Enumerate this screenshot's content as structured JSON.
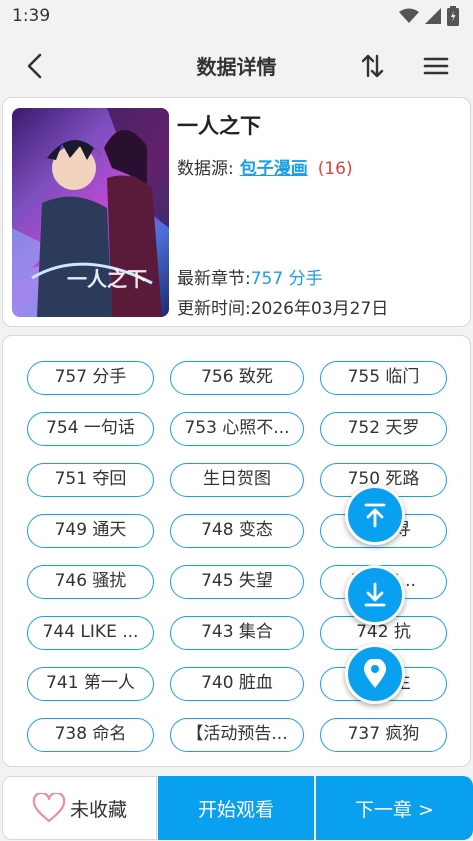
{
  "status_bar": {
    "time": "1:39",
    "icons": [
      "wifi-icon",
      "signal-icon",
      "battery-icon"
    ]
  },
  "toolbar": {
    "title": "数据详情",
    "icons": [
      "back-arrow-icon",
      "sort-icon",
      "menu-icon"
    ]
  },
  "comic": {
    "title": "一人之下",
    "source_label": "数据源:",
    "source_name": "包子漫画",
    "source_count": "(16)",
    "latest_label": "最新章节:",
    "latest_value": "757 分手",
    "updated_label": "更新时间:",
    "updated_value": "2026年03月27日"
  },
  "chapters": [
    "757 分手",
    "756 致死",
    "755 临门",
    "754 一句话",
    "753 心照不...",
    "752 天罗",
    "751 夺回",
    "生日贺图",
    "750 死路",
    "749 通天",
    "748 变态",
    "747 寻",
    "746 骚扰",
    "745 失望",
    "744 6...",
    "744 LIKE ...",
    "743 集合",
    "742 抗",
    "741 第一人",
    "740 脏血",
    "739 生",
    "738 命名",
    "【活动预告...",
    "737 疯狗"
  ],
  "fabs": [
    "scroll-top-icon",
    "scroll-bottom-icon",
    "location-icon"
  ],
  "bottom_bar": {
    "favorite_label": "未收藏",
    "watch_label": "开始观看",
    "next_label": "下一章 >"
  },
  "colors": {
    "accent": "#0aa0f0",
    "link": "#1a9ee8",
    "count": "#e04040"
  }
}
